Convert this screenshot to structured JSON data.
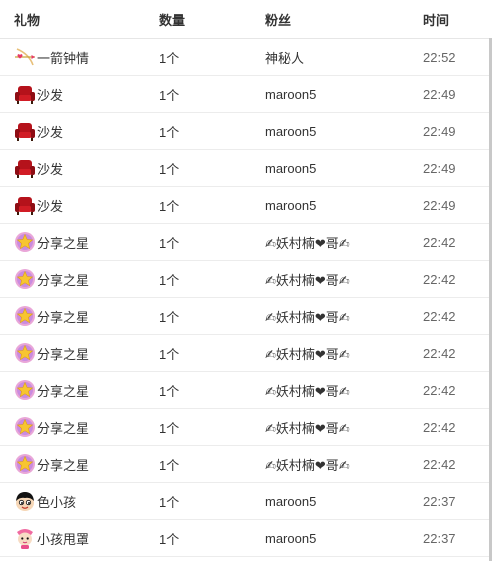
{
  "headers": {
    "gift": "礼物",
    "quantity": "数量",
    "fan": "粉丝",
    "time": "时间"
  },
  "rows": [
    {
      "icon": "cupid-arrow-icon",
      "gift": "一箭钟情",
      "quantity": "1个",
      "fan": "神秘人",
      "time": "22:52"
    },
    {
      "icon": "sofa-icon",
      "gift": "沙发",
      "quantity": "1个",
      "fan": "maroon5",
      "time": "22:49"
    },
    {
      "icon": "sofa-icon",
      "gift": "沙发",
      "quantity": "1个",
      "fan": "maroon5",
      "time": "22:49"
    },
    {
      "icon": "sofa-icon",
      "gift": "沙发",
      "quantity": "1个",
      "fan": "maroon5",
      "time": "22:49"
    },
    {
      "icon": "sofa-icon",
      "gift": "沙发",
      "quantity": "1个",
      "fan": "maroon5",
      "time": "22:49"
    },
    {
      "icon": "star-icon",
      "gift": "分享之星",
      "quantity": "1个",
      "fan": "✍妖村楠❤哥✍",
      "time": "22:42"
    },
    {
      "icon": "star-icon",
      "gift": "分享之星",
      "quantity": "1个",
      "fan": "✍妖村楠❤哥✍",
      "time": "22:42"
    },
    {
      "icon": "star-icon",
      "gift": "分享之星",
      "quantity": "1个",
      "fan": "✍妖村楠❤哥✍",
      "time": "22:42"
    },
    {
      "icon": "star-icon",
      "gift": "分享之星",
      "quantity": "1个",
      "fan": "✍妖村楠❤哥✍",
      "time": "22:42"
    },
    {
      "icon": "star-icon",
      "gift": "分享之星",
      "quantity": "1个",
      "fan": "✍妖村楠❤哥✍",
      "time": "22:42"
    },
    {
      "icon": "star-icon",
      "gift": "分享之星",
      "quantity": "1个",
      "fan": "✍妖村楠❤哥✍",
      "time": "22:42"
    },
    {
      "icon": "star-icon",
      "gift": "分享之星",
      "quantity": "1个",
      "fan": "✍妖村楠❤哥✍",
      "time": "22:42"
    },
    {
      "icon": "cartoon-boy-icon",
      "gift": "色小孩",
      "quantity": "1个",
      "fan": "maroon5",
      "time": "22:37"
    },
    {
      "icon": "cartoon-girl-icon",
      "gift": "小孩甩罩",
      "quantity": "1个",
      "fan": "maroon5",
      "time": "22:37"
    }
  ]
}
